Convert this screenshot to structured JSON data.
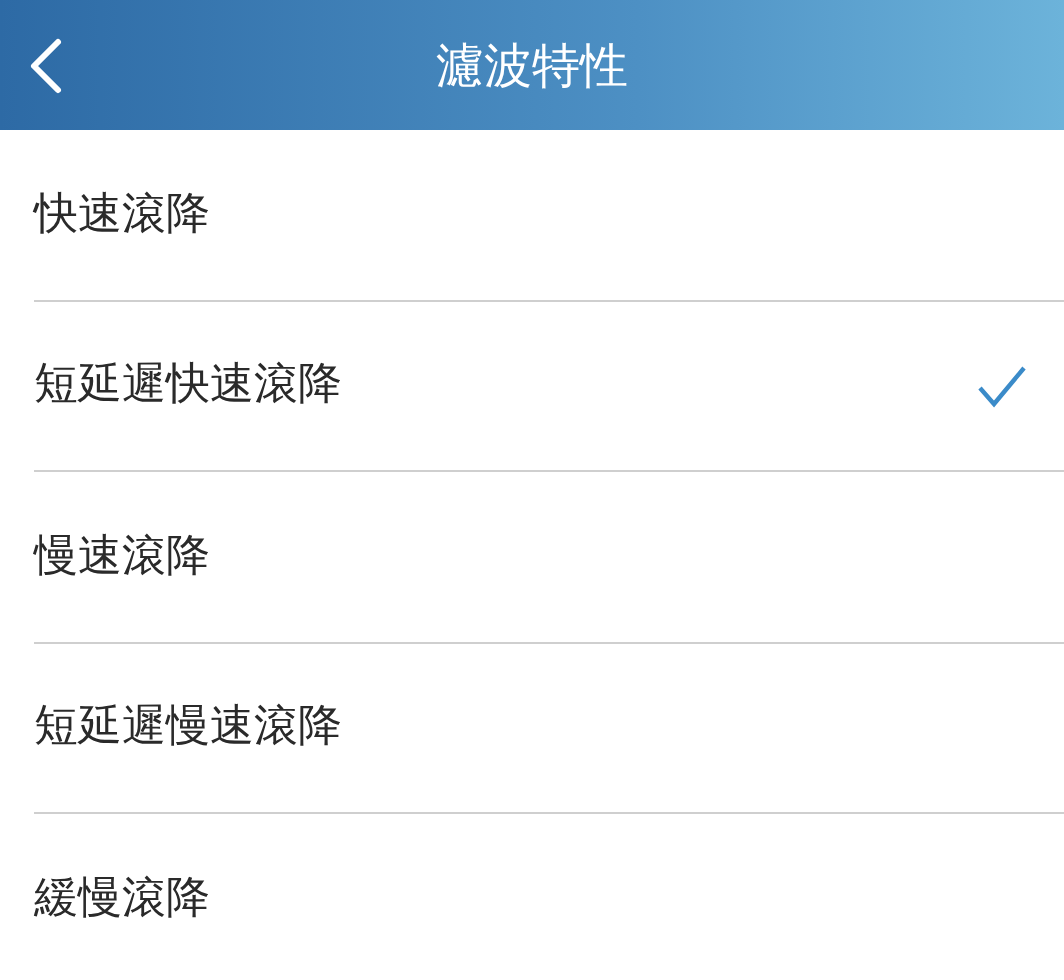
{
  "header": {
    "title": "濾波特性"
  },
  "options": [
    {
      "label": "快速滾降",
      "selected": false
    },
    {
      "label": "短延遲快速滾降",
      "selected": true
    },
    {
      "label": "慢速滾降",
      "selected": false
    },
    {
      "label": "短延遲慢速滾降",
      "selected": false
    },
    {
      "label": "緩慢滾降",
      "selected": false
    }
  ]
}
